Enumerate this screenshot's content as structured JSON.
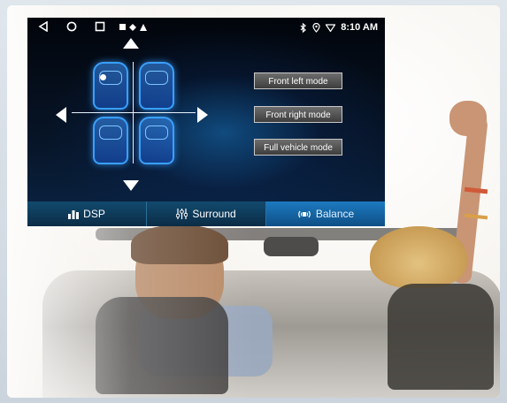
{
  "statusbar": {
    "time": "8:10 AM",
    "icons": [
      "back-icon",
      "home-icon",
      "recents-icon",
      "bluetooth-icon",
      "location-icon",
      "wifi-icon"
    ]
  },
  "balance": {
    "mode_buttons": [
      {
        "label": "Front left mode"
      },
      {
        "label": "Front right mode"
      },
      {
        "label": "Full vehicle mode"
      }
    ]
  },
  "tabs": [
    {
      "label": "DSP",
      "icon": "equalizer-bars-icon"
    },
    {
      "label": "Surround",
      "icon": "sliders-icon"
    },
    {
      "label": "Balance",
      "icon": "speaker-waves-icon",
      "active": true
    }
  ],
  "colors": {
    "accent": "#1c7ac0",
    "seat_glow": "#3aa0ff"
  }
}
